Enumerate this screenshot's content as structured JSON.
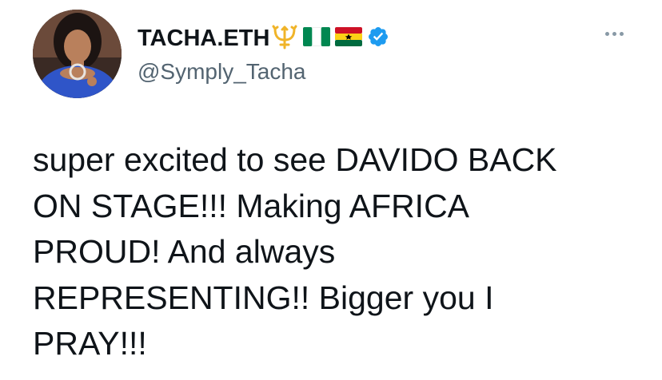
{
  "author": {
    "display_name": "TACHA.ETH",
    "handle": "@Symply_Tacha",
    "emoji_icons": [
      "trident-icon",
      "nigeria-flag-icon",
      "ghana-flag-icon"
    ],
    "verified": true
  },
  "tweet": {
    "text": "super excited to see DAVIDO BACK\nON STAGE!!! Making AFRICA\nPROUD! And always\nREPRESENTING!! Bigger you I\nPRAY!!!"
  },
  "colors": {
    "text": "#0f1419",
    "handle": "#536471",
    "verified_badge": "#1d9bf0",
    "trident": "#f0b429",
    "nigeria_green": "#008751",
    "ghana_red": "#ce1126",
    "ghana_gold": "#fcd116",
    "ghana_green": "#006b3f"
  }
}
